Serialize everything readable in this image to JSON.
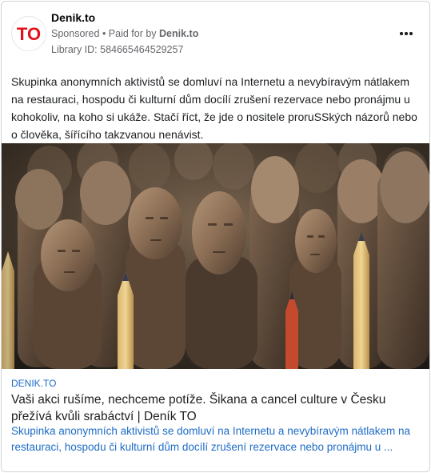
{
  "header": {
    "page_name": "Denik.to",
    "sponsored_label": "Sponsored",
    "bullet": " • ",
    "paid_for_prefix": "Paid for by ",
    "paid_for_name": "Denik.to",
    "library_id": "Library ID: 584665464529257",
    "avatar_text": "TO",
    "more_icon": "more-horizontal-icon"
  },
  "post": {
    "text": "Skupinka anonymních aktivistů se domluví na Internetu a nevybíravým nátlakem na restauraci, hospodu či kulturní dům docílí zrušení rezervace nebo pronájmu u kohokoliv, na koho si ukáže. Stačí říct, že jde o nositele proruSSkých názorů nebo o člověka, šířícího takzvanou nenávist."
  },
  "link_preview": {
    "domain": "DENIK.TO",
    "title": "Vaši akci rušíme, nechceme potíže. Šikana a cancel culture v Česku přežívá kvůli srabáctví | Deník TO",
    "description": "Skupinka anonymních aktivistů se domluví na Internetu a nevybíravým nátlakem na restauraci, hospodu či kulturní dům docílí zrušení rezervace nebo pronájmu u ..."
  },
  "colors": {
    "brand_red": "#e3101b",
    "link_blue": "#1e6cc6",
    "meta_gray": "#65676b"
  }
}
